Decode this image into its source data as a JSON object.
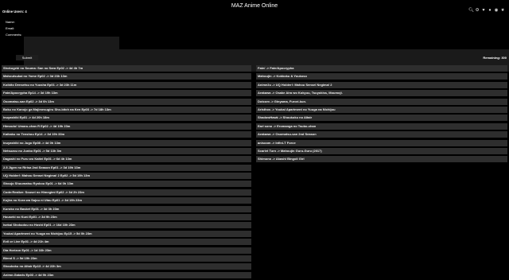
{
  "header": {
    "online_label": "Online Users: 4",
    "title": "MAZ Anime Online"
  },
  "icons": [
    "search-icon",
    "gear-icon",
    "heart-icon",
    "user-icon",
    "globe-icon",
    "star-icon"
  ],
  "form": {
    "name_label": "Name:",
    "email_label": "Email:",
    "comments_label": "Comments:",
    "submit_label": "Submit",
    "remaining": "Remaining: 300"
  },
  "left_items": [
    "Shokugeki no Souma: San no Sara Ep02 -> 4d 4h 7m",
    "Mahoutsukai no Yome Ep02 -> 3d 23h 13m",
    "Koibito Densetsu no Yuusha Ep01 -> 3d 23h 11m",
    "Fate/Apocrypha Ep14 -> 3d 19h 13m",
    "Osomatsu-san Ep02 -> 3d 0h 13m",
    "Boku no Kanojo ga Majimesugiru Sho-bitch na Ken Ep03 -> 7d 18h 13m",
    "Inuyashiki Ep01 -> 4d 20h 18m",
    "Himouto! Umaru-chan R Ep02 -> 4d 19h 23m",
    "Kaikaku no Tenshou Ep14 -> 3d 19h 33m",
    "Inuyashiki no Jugo Ep08 -> 4d 0h 13m",
    "Netsuzou no Junbo Ep01 -> 5d 13h 3m",
    "Dagashi no Furu wo Kaitei Ep01 -> 6d 4h 13m",
    "2.5 Jigen no Ririsa 2nd Season Ep01 -> 3d 19h 13m",
    "UQ Holder!: Mahou Sensei Negima! 2 Ep02 -> 5d 19h 13m",
    "Shoujo Shuumatsu Ryokou Ep01 -> 6d 0h 13m",
    "Code:Realize: Sousei no Himegimi Ep02 -> 3d 2h 23m",
    "Kujira no Kora wa Sajou ni Utau Ep01 -> 3d 19h 23m",
    "Kuroko no Basket Ep01 -> 3d 3h 23m",
    "Houseki no Kuni Ep01 -> 3d 9h 23m",
    "Isekai Shokudou no Hoshi Ep01 -> 16d 10h 23m",
    "Youkai Apartment no Yuuga na Nichijou Ep15 -> 5d 0h 23m",
    "Evil or Live Ep01 -> 4d 21h 4m",
    "Dia Horizon Ep01 -> 1d 16h 23m",
    "Blend S -> 5d 19h 23m",
    "Shoukoku no Altair Ep13 -> 4d 22h 3m",
    "Anime-Gataris Ep03 -> 4d 9h 23m"
  ],
  "right_items": [
    "Fate/ -> Fate/Apocrypha",
    "Mahoujin -> Kokkoku & Youkoso",
    "Anime2u -> UQ Holder!: Mahou Sensei Negima! 2",
    "Arakawa -> Osake Aira wo Kokyuu, Tsuyokiss, Moumoji.",
    "Dotcom -> Ginyama, Furori-kun.",
    "Aristhos -> Youkai Apartment no Yuuga na Nichijou",
    "ShadowHawk -> Shoukoku no Altair",
    "Earl sono -> Eromanga no Tsubo-chan",
    "Arakawa -> Osomatsu-san 2nd Season",
    "anisoom -> Infini-T Force",
    "Scarlet Turn -> Mahoujin Guru-Guru (2017)",
    "Shimono -> Akashi Bingoli Girl"
  ]
}
